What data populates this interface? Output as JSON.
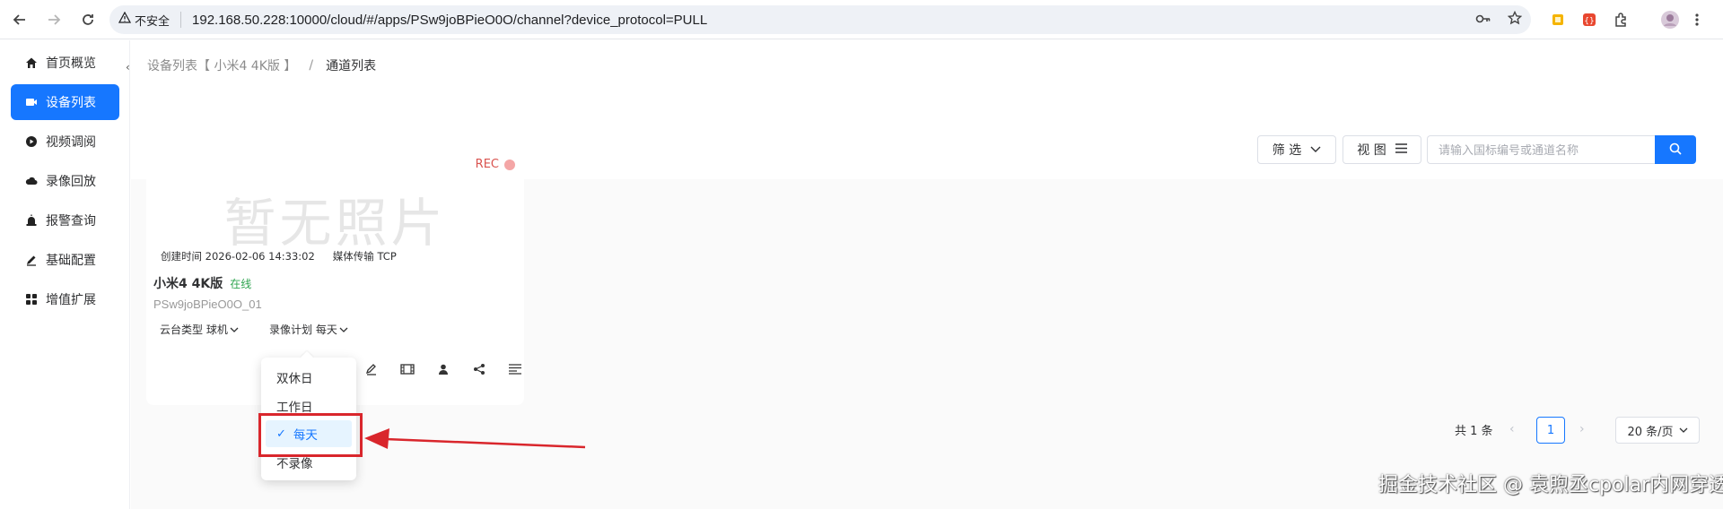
{
  "browser": {
    "insecure_label": "不安全",
    "url": "192.168.50.228:10000/cloud/#/apps/PSw9joBPieO0O/channel?device_protocol=PULL",
    "icons": [
      "back-icon",
      "forward-icon",
      "reload-icon",
      "key-icon",
      "star-icon",
      "extension-icon",
      "profile-avatar"
    ]
  },
  "sidebar": {
    "items": [
      {
        "label": "首页概览",
        "icon": "home-icon"
      },
      {
        "label": "设备列表",
        "icon": "camera-icon",
        "active": true
      },
      {
        "label": "视频调阅",
        "icon": "play-icon"
      },
      {
        "label": "录像回放",
        "icon": "cloud-icon"
      },
      {
        "label": "报警查询",
        "icon": "alarm-icon"
      },
      {
        "label": "基础配置",
        "icon": "edit-icon"
      },
      {
        "label": "增值扩展",
        "icon": "grid-icon"
      }
    ]
  },
  "breadcrumb": {
    "parent": "设备列表【 小米4 4K版 】",
    "separator": "/",
    "current": "通道列表"
  },
  "filters": {
    "filter_label": "筛 选",
    "view_label": "视 图",
    "search_placeholder": "请输入国标编号或通道名称"
  },
  "card": {
    "rec_label": "REC",
    "no_photo": "暂无照片",
    "created_label": "创建时间 2026-02-06 14:33:02",
    "transport_label": "媒体传输 TCP",
    "device_name": "小米4 4K版",
    "status": "在线",
    "device_id": "PSw9joBPieO0O_01",
    "ptz_type": "云台类型 球机",
    "record_plan": "录像计划 每天",
    "actions": [
      "edit-icon",
      "film-icon",
      "user-icon",
      "share-icon",
      "list-icon"
    ]
  },
  "record_plan_menu": {
    "options": [
      "双休日",
      "工作日",
      "每天",
      "不录像"
    ],
    "selected": "每天"
  },
  "pagination": {
    "total": "共 1 条",
    "current_page": "1",
    "page_size": "20 条/页"
  },
  "watermark": "掘金技术社区 @ 袁煦丞cpolar内网穿透实验室",
  "colors": {
    "accent": "#1677ff",
    "online": "#2ea44f",
    "rec": "#d9534f",
    "annotation": "#d9262c"
  }
}
